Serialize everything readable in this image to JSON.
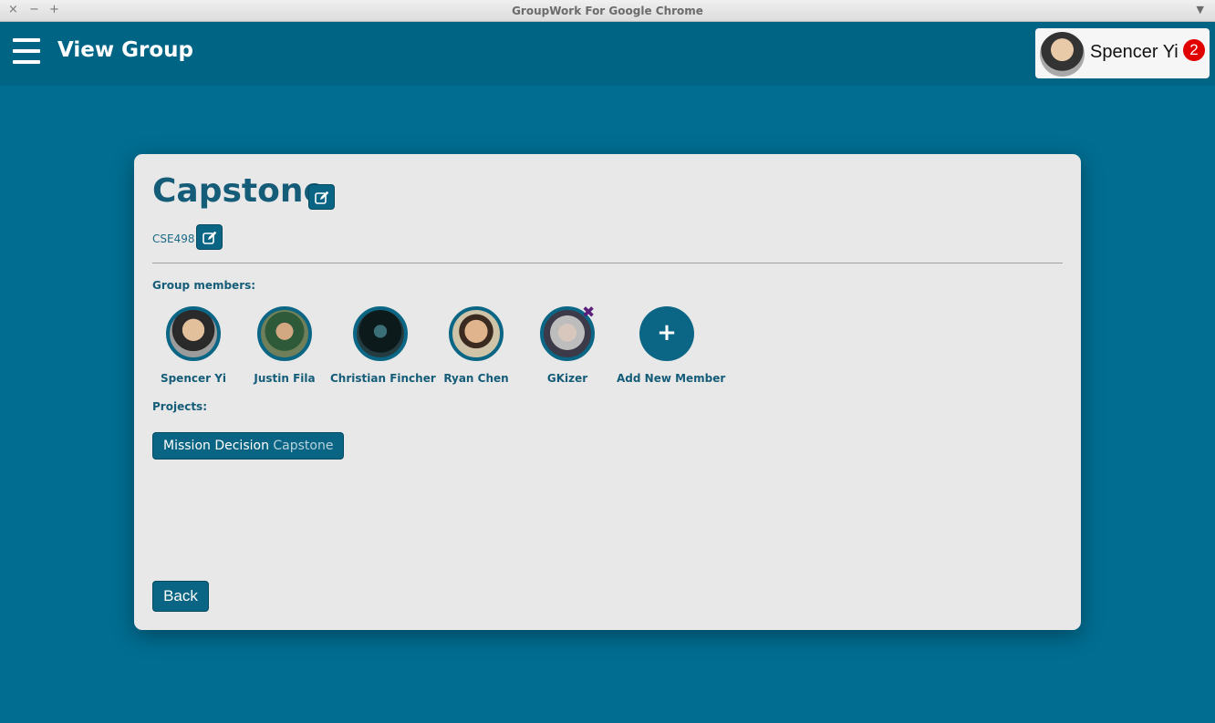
{
  "window": {
    "title": "GroupWork For Google Chrome",
    "controls": [
      "×",
      "−",
      "+"
    ],
    "menu_icon": "chevron-down-icon"
  },
  "header": {
    "title": "View Group",
    "menu_icon": "hamburger-icon",
    "user": {
      "name": "Spencer Yi",
      "notification_count": "2"
    }
  },
  "group": {
    "name": "Capstone",
    "course": "CSE498",
    "members_label": "Group members:",
    "members": [
      {
        "name": "Spencer Yi"
      },
      {
        "name": "Justin Fila"
      },
      {
        "name": "Christian Fincher"
      },
      {
        "name": "Ryan Chen"
      },
      {
        "name": "GKizer",
        "removable": true
      }
    ],
    "add_member_label": "Add New Member",
    "projects_label": "Projects:",
    "projects": [
      {
        "name": "Mission Decision",
        "group": "Capstone"
      }
    ],
    "back_label": "Back"
  },
  "colors": {
    "background": "#006d91",
    "header": "#006585",
    "accent": "#0a6484",
    "text": "#145c78",
    "badge": "#e00000",
    "remove": "#5a1f7a"
  }
}
